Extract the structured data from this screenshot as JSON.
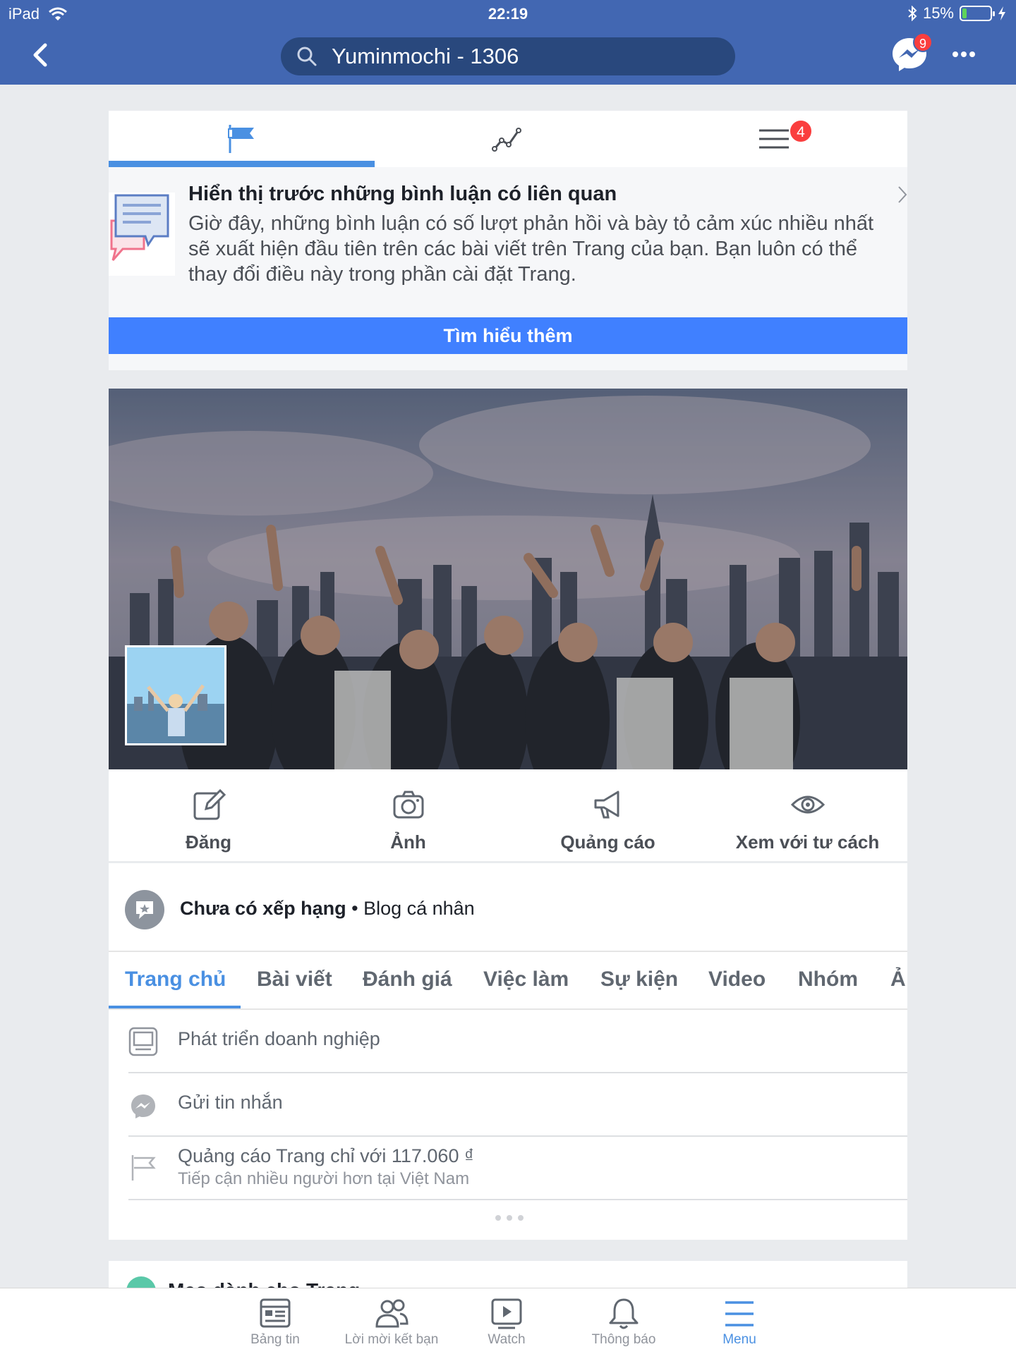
{
  "status_bar": {
    "device": "iPad",
    "time": "22:19",
    "battery": "15%"
  },
  "header": {
    "search_text": "Yuminmochi - 1306",
    "messenger_badge": "9"
  },
  "page_tabs_top": {
    "menu_badge": "4"
  },
  "notice": {
    "title": "Hiển thị trước những bình luận có liên quan",
    "body": "Giờ đây, những bình luận có số lượt phản hồi và bày tỏ cảm xúc nhiều nhất sẽ xuất hiện đầu tiên trên các bài viết trên Trang của bạn. Bạn luôn có thể thay đổi điều này trong phần cài đặt Trang.",
    "cta": "Tìm hiểu thêm"
  },
  "actions": [
    "Đăng",
    "Ảnh",
    "Quảng cáo",
    "Xem với tư cách"
  ],
  "category": {
    "rating": "Chưa có xếp hạng",
    "separator": " • ",
    "type": "Blog cá nhân"
  },
  "page_tabs": [
    "Trang chủ",
    "Bài viết",
    "Đánh giá",
    "Việc làm",
    "Sự kiện",
    "Video",
    "Nhóm",
    "Ả"
  ],
  "list": {
    "item1": "Phát triển doanh nghiệp",
    "item2": "Gửi tin nhắn",
    "item3_title": "Quảng cáo Trang chỉ với 117.060 ₫",
    "item3_sub": "Tiếp cận nhiều người hơn tại Việt Nam"
  },
  "next_section": {
    "title": "Mẹo dành cho Trang"
  },
  "bottom_tabs": [
    "Bảng tin",
    "Lời mời kết bạn",
    "Watch",
    "Thông báo",
    "Menu"
  ],
  "colors": {
    "brand": "#4267b2",
    "accent": "#4a90e2",
    "cta": "#4080ff",
    "badge": "#fa3e3e"
  }
}
